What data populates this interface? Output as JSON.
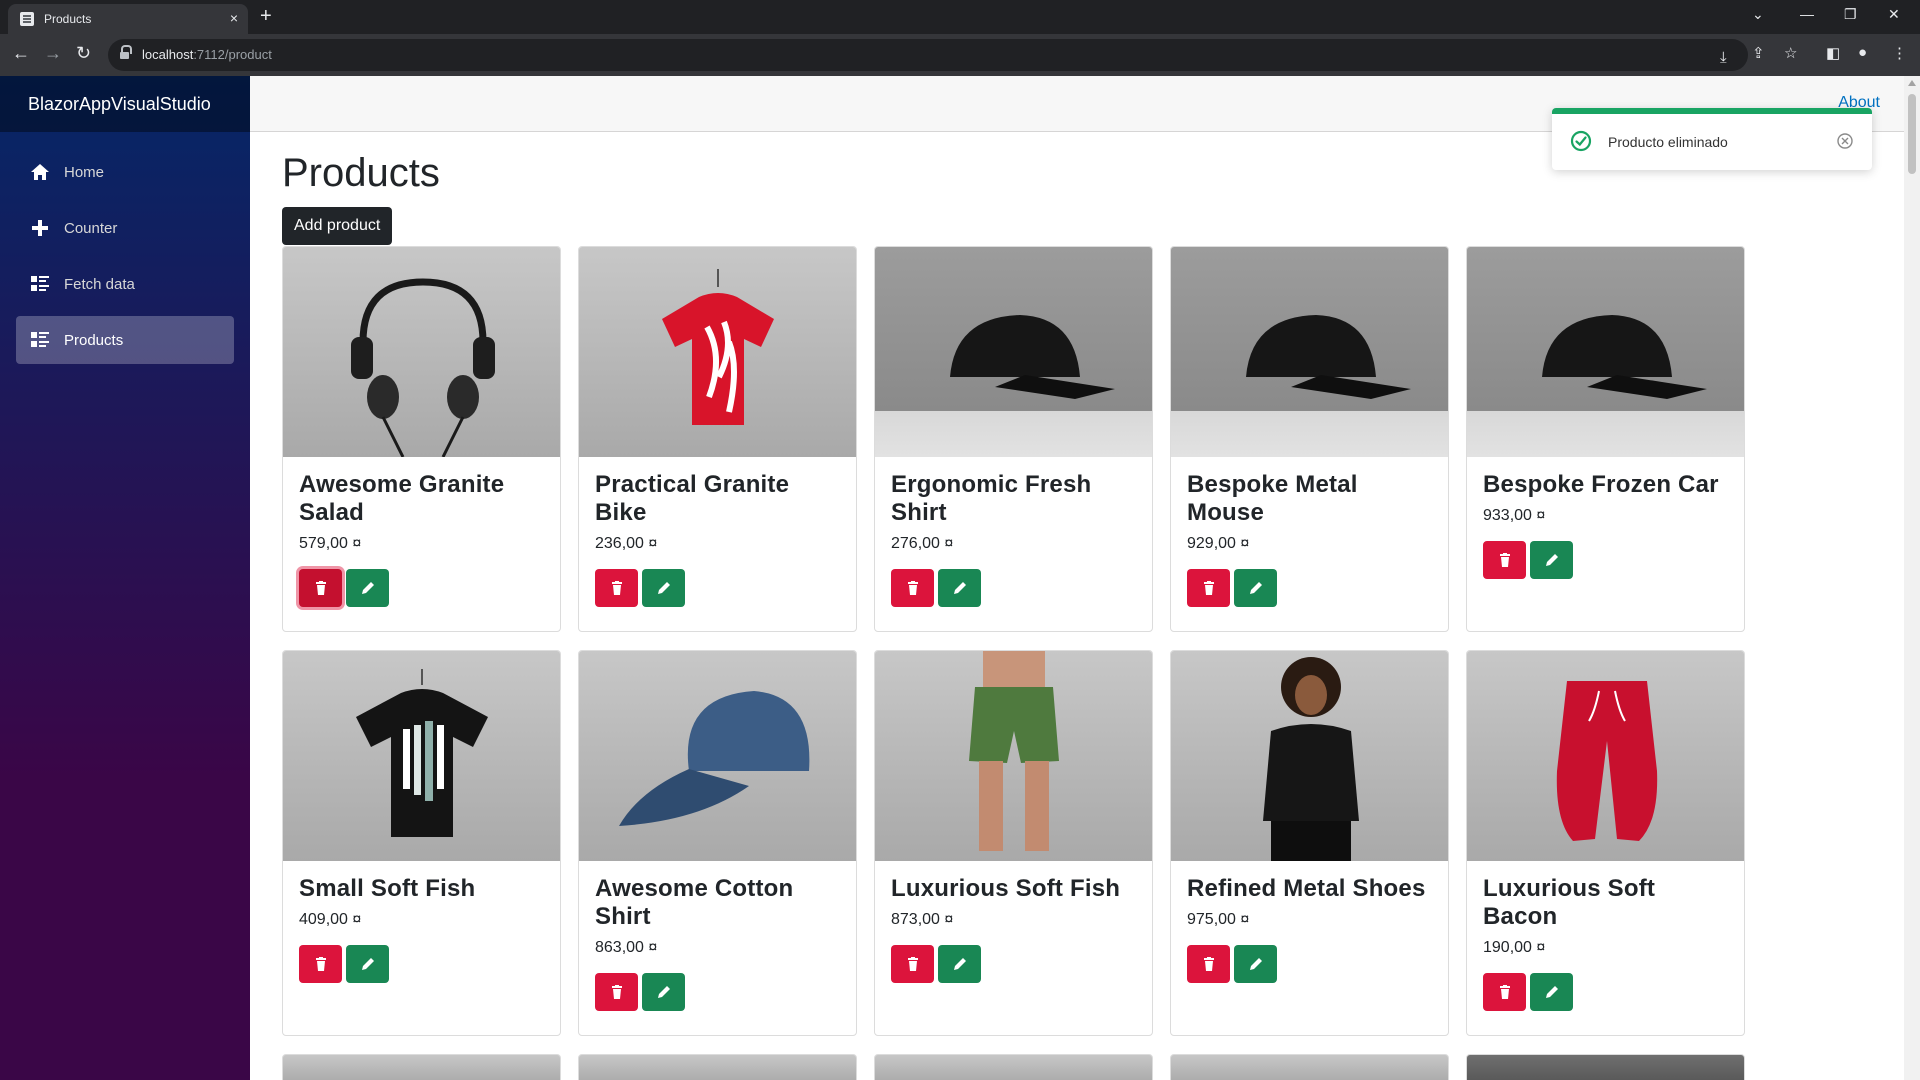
{
  "browser": {
    "tab_title": "Products",
    "tab_close": "×",
    "new_tab": "+",
    "url_host": "localhost",
    "url_path": ":7112/product"
  },
  "sidebar": {
    "brand": "BlazorAppVisualStudio",
    "items": [
      {
        "label": "Home",
        "icon": "home-icon",
        "active": false
      },
      {
        "label": "Counter",
        "icon": "plus-icon",
        "active": false
      },
      {
        "label": "Fetch data",
        "icon": "list-rich-icon",
        "active": false
      },
      {
        "label": "Products",
        "icon": "list-rich-icon",
        "active": true
      }
    ]
  },
  "topbar": {
    "about_label": "About"
  },
  "main": {
    "title": "Products",
    "add_button_label": "Add product",
    "products": [
      {
        "name": "Awesome Granite Salad",
        "price": "579,00 ¤",
        "image": "headphones"
      },
      {
        "name": "Practical Granite Bike",
        "price": "236,00 ¤",
        "image": "red-tshirt"
      },
      {
        "name": "Ergonomic Fresh Shirt",
        "price": "276,00 ¤",
        "image": "black-cap"
      },
      {
        "name": "Bespoke Metal Mouse",
        "price": "929,00 ¤",
        "image": "black-cap"
      },
      {
        "name": "Bespoke Frozen Car",
        "price": "933,00 ¤",
        "image": "black-cap"
      },
      {
        "name": "Small Soft Fish",
        "price": "409,00 ¤",
        "image": "black-tshirt"
      },
      {
        "name": "Awesome Cotton Shirt",
        "price": "863,00 ¤",
        "image": "blue-cap"
      },
      {
        "name": "Luxurious Soft Fish",
        "price": "873,00 ¤",
        "image": "green-shorts"
      },
      {
        "name": "Refined Metal Shoes",
        "price": "975,00 ¤",
        "image": "woman-tshirt"
      },
      {
        "name": "Luxurious Soft Bacon",
        "price": "190,00 ¤",
        "image": "red-pants"
      }
    ]
  },
  "toast": {
    "message": "Producto eliminado",
    "icon": "check-circle-icon"
  },
  "colors": {
    "delete": "#dc143c",
    "edit": "#198754",
    "toast_accent": "#19a463",
    "link": "#0071c1"
  }
}
